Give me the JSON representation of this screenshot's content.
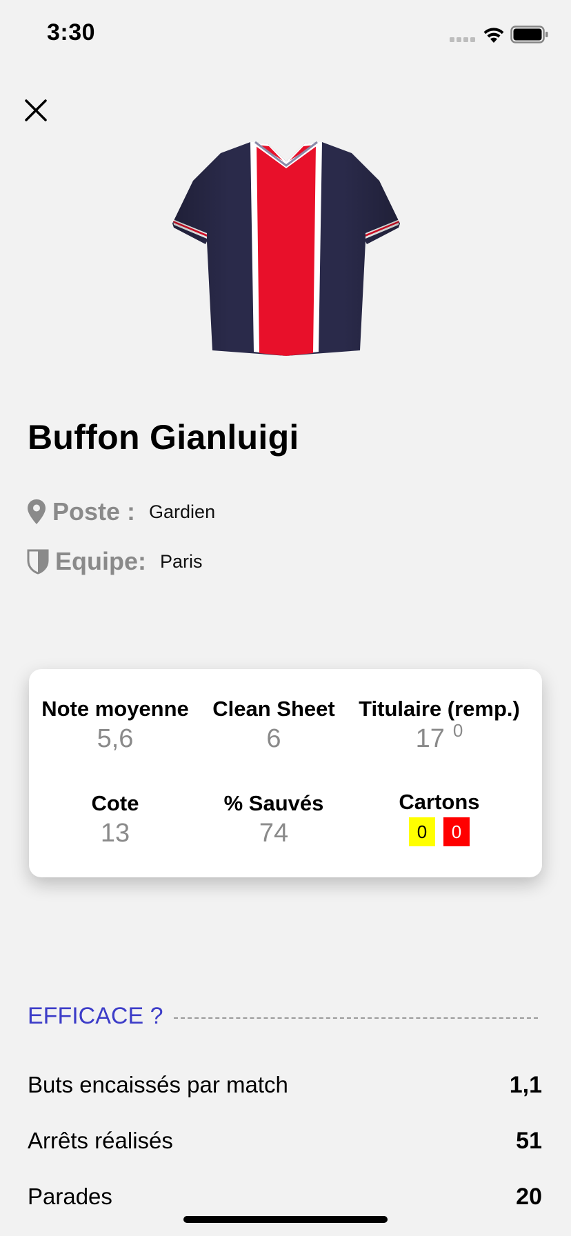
{
  "status_bar": {
    "time": "3:30"
  },
  "player": {
    "name": "Buffon Gianluigi"
  },
  "info": {
    "poste_label": "Poste :",
    "poste_value": "Gardien",
    "equipe_label": "Equipe:",
    "equipe_value": "Paris"
  },
  "jersey": {
    "primary_color": "#2a2a4a",
    "stripe_color": "#e8102a",
    "trim_color": "#ffffff"
  },
  "stats": {
    "note_moyenne": {
      "label": "Note moyenne",
      "value": "5,6"
    },
    "clean_sheet": {
      "label": "Clean Sheet",
      "value": "6"
    },
    "titulaire": {
      "label": "Titulaire (remp.)",
      "value": "17",
      "sub": "0"
    },
    "cote": {
      "label": "Cote",
      "value": "13"
    },
    "sauves": {
      "label": "% Sauvés",
      "value": "74"
    },
    "cartons": {
      "label": "Cartons",
      "yellow": "0",
      "red": "0"
    }
  },
  "section": {
    "title": "EFFICACE ?"
  },
  "metrics": [
    {
      "label": "Buts encaissés par match",
      "value": "1,1"
    },
    {
      "label": "Arrêts réalisés",
      "value": "51"
    },
    {
      "label": "Parades",
      "value": "20"
    }
  ],
  "colors": {
    "accent": "#3c3cc8",
    "card_yellow": "#ffff00",
    "card_red": "#ff0000"
  }
}
